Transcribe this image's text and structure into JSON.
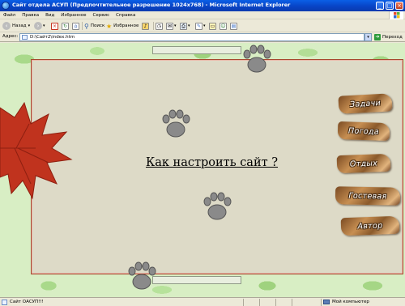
{
  "window": {
    "title": "Сайт отдела АСУП (Предпочтительное разрешение 1024x768) - Microsoft Internet Explorer",
    "buttons": {
      "minimize": "_",
      "maximize": "□",
      "close": "×"
    }
  },
  "menu": [
    "Файл",
    "Правка",
    "Вид",
    "Избранное",
    "Сервис",
    "Справка"
  ],
  "toolbar": {
    "back_label": "Назад",
    "search_label": "Поиск",
    "favorites_label": "Избранное"
  },
  "address": {
    "label": "Адрес:",
    "value": "D:\\Сайт2\\index.htm",
    "go_label": "Переход"
  },
  "page": {
    "main_link": "Как настроить сайт ?",
    "nav_buttons": [
      "Задачи",
      "Погода",
      "Отдых",
      "Гостевая",
      "Автор"
    ]
  },
  "status": {
    "text": "Сайт ОАСУП!!!",
    "zone": "Мой компьютер"
  },
  "colors": {
    "titlebar": "#0A5FE6",
    "leaf_green": "#A9D98A",
    "panel_bg": "#DDDAC7",
    "panel_border": "#A6482F",
    "maple_red": "#C0331E",
    "wood": "#C78F52"
  }
}
